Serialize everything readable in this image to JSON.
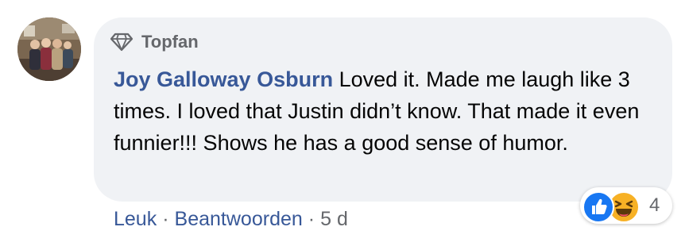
{
  "comment": {
    "badge": {
      "icon": "diamond-icon",
      "label": "Topfan"
    },
    "author": "Joy Galloway Osburn",
    "text": "Loved it. Made me laugh like 3 times. I loved that Justin didn’t know. That made it even funnier!!! Shows he has a good sense of humor.",
    "reactions": {
      "icons": [
        "like-icon",
        "haha-icon"
      ],
      "count": "4"
    },
    "actions": {
      "like_label": "Leuk",
      "separator": "·",
      "reply_label": "Beantwoorden",
      "timestamp": "5 d"
    }
  },
  "colors": {
    "bubble_bg": "#f0f2f5",
    "author": "#385898",
    "meta": "#65676b",
    "like_blue": "#1877f2",
    "haha_yellow": "#f7b125"
  }
}
